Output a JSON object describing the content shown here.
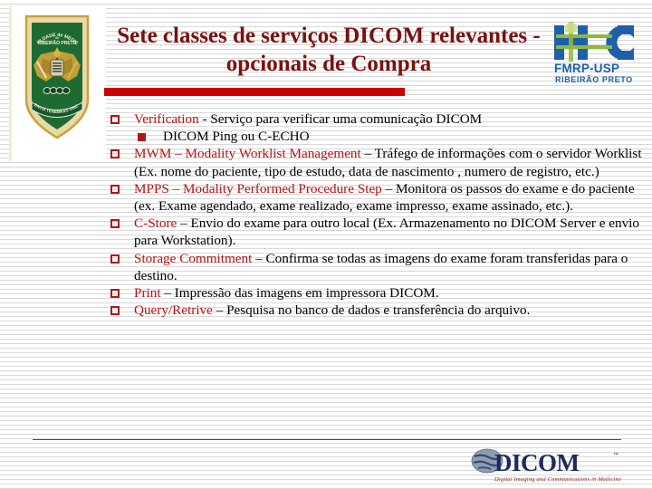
{
  "slide": {
    "title": "Sete classes de serviços DICOM relevantes - opcionais de Compra",
    "accent_color": "#cc0000",
    "title_color": "#7b1010",
    "term_color": "#b01616",
    "background_color": "#ffffff"
  },
  "crest": {
    "name": "faculdade-de-medicina-de-ribeirao-preto-crest",
    "line1": "FACULDADE de MEDICINA",
    "line2": "de",
    "line3": "RIBEIRÃO PRETO",
    "motto_left": "SCIENTIA",
    "motto_right": "VINCERE",
    "motto_center": "TENEBRAS",
    "shield_color": "#1d6b33",
    "trim_color": "#c9a13a"
  },
  "hc_logo": {
    "name": "hc-fmrp-usp-logo",
    "mark": "HC",
    "line1": "FMRP-USP",
    "line2": "RIBEIRÃO PRETO",
    "blue": "#1f5fa9",
    "green": "#8fb83e"
  },
  "bullets": [
    {
      "level": 1,
      "marker": "square-outline",
      "term": "Verification",
      "rest": " - Serviço para verificar uma comunicação DICOM"
    },
    {
      "level": 2,
      "marker": "square-filled",
      "term": "",
      "rest": "DICOM Ping ou C-ECHO"
    },
    {
      "level": 1,
      "marker": "square-outline",
      "term": "MWM – Modality Worklist Management",
      "rest": " – Tráfego de informações com o servidor Worklist (Ex. nome do paciente, tipo de estudo, data de nascimento , numero de registro, etc.)"
    },
    {
      "level": 1,
      "marker": "square-outline",
      "term": "MPPS – Modality Performed Procedure Step",
      "rest": " – Monitora os passos do exame e do paciente (ex. Exame agendado, exame realizado, exame impresso, exame assinado, etc.)."
    },
    {
      "level": 1,
      "marker": "square-outline",
      "term": "C-Store",
      "rest": " – Envio do exame para outro local (Ex. Armazenamento no DICOM Server e envio para Workstation)."
    },
    {
      "level": 1,
      "marker": "square-outline",
      "term": "Storage Commitment",
      "rest": " – Confirma se todas as imagens do exame foram transferidas para o destino."
    },
    {
      "level": 1,
      "marker": "square-outline",
      "term": "Print",
      "rest": " – Impressão das imagens em impressora DICOM."
    },
    {
      "level": 1,
      "marker": "square-outline",
      "term": "Query/Retrive",
      "rest": " – Pesquisa no banco de dados e transferência do arquivo."
    }
  ],
  "footer": {
    "dicom_logo": {
      "name": "dicom-logo",
      "wordmark": "DICOM",
      "trademark": "™",
      "tagline": "Digital Imaging and Communications in Medicine",
      "color": "#1b2a5e",
      "tagline_color": "#8a2b2b"
    },
    "rule_color": "#8a2b2b"
  }
}
